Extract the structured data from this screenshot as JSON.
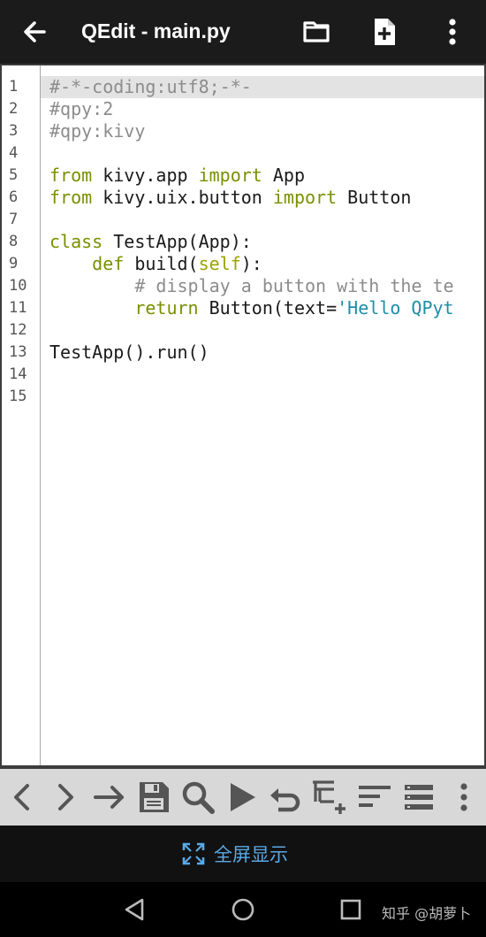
{
  "app": {
    "title": "QEdit - main.py"
  },
  "editor": {
    "line_numbers": [
      "1",
      "2",
      "3",
      "4",
      "5",
      "6",
      "7",
      "8",
      "9",
      "10",
      "11",
      "12",
      "13",
      "14",
      "15"
    ],
    "lines": [
      "#-*-coding:utf8;-*-",
      "#qpy:2",
      "#qpy:kivy",
      "",
      "from kivy.app import App",
      "from kivy.uix.button import Button",
      "",
      "class TestApp(App):",
      "    def build(self):",
      "        # display a button with the te",
      "        return Button(text='Hello QPyt",
      "",
      "TestApp().run()",
      "",
      ""
    ],
    "tokens": {
      "l1": "#-*-coding:utf8;-*-",
      "l2": "#qpy:2",
      "l3": "#qpy:kivy",
      "l5_kw1": "from",
      "l5_a": " kivy.app ",
      "l5_kw2": "import",
      "l5_b": " App",
      "l6_kw1": "from",
      "l6_a": " kivy.uix.button ",
      "l6_kw2": "import",
      "l6_b": " Button",
      "l8_kw": "class",
      "l8_a": " TestApp(App):",
      "l9_indent": "    ",
      "l9_kw": "def",
      "l9_a": " build(",
      "l9_self": "self",
      "l9_b": "):",
      "l10_indent": "        ",
      "l10_cm": "# display a button with the te",
      "l11_indent": "        ",
      "l11_kw": "return",
      "l11_a": " Button(text=",
      "l11_st": "'Hello QPyt",
      "l13": "TestApp().run()"
    },
    "current_line": 1
  },
  "toolbar": {
    "icons": [
      "chevron-left-icon",
      "chevron-right-icon",
      "arrow-right-icon",
      "save-icon",
      "search-icon",
      "run-icon",
      "undo-icon",
      "indent-icon",
      "align-left-icon",
      "list-icon",
      "more-vert-icon"
    ]
  },
  "fullscreen": {
    "label": "全屏显示"
  },
  "watermark": {
    "text": "知乎 @胡萝卜"
  },
  "colors": {
    "appbar_bg": "#1b1b1b",
    "keyword": "#7a8f00",
    "comment": "#8c8c8c",
    "string": "#1d8fa8",
    "toolbar_bg": "#d8d8d8",
    "fullscreen_label": "#5aa9e6"
  }
}
